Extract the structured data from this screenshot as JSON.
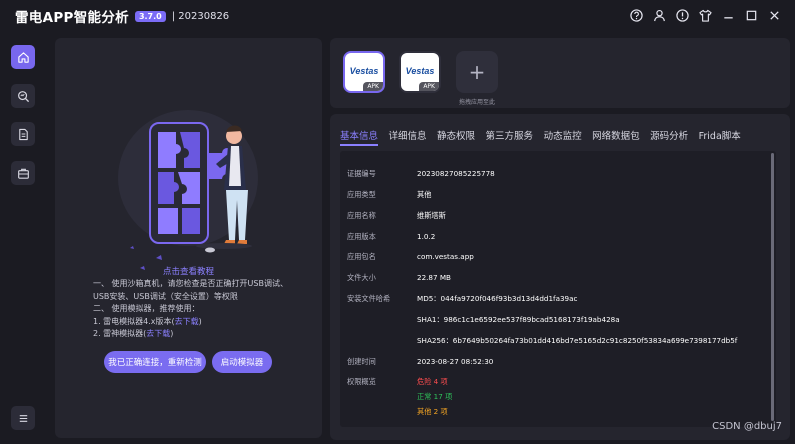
{
  "titlebar": {
    "app_name": "雷电APP智能分析",
    "version": "3.7.0",
    "build": "| 20230826",
    "icons": [
      "help-icon",
      "user-icon",
      "info-icon",
      "theme-icon",
      "minimize-icon",
      "maximize-icon",
      "close-icon"
    ]
  },
  "sidebar": {
    "items": [
      "home-icon",
      "analysis-icon",
      "report-icon",
      "toolbox-icon"
    ],
    "menu": "menu-icon",
    "accent": "#7867ee"
  },
  "guide": {
    "title": "点击查看教程",
    "line1": "一、 使用沙箱真机，请您检查是否正确打开USB调试、USB安装、USB调试（安全设置）等权限",
    "line2": "二、 使用模拟器，推荐使用：",
    "line3_prefix": "1. 雷电模拟器4.x版本(",
    "line3_link": "去下载",
    "line3_suffix": ")",
    "line4_prefix": "2. 雷神模拟器(",
    "line4_link": "去下载",
    "line4_suffix": ")",
    "btn_connected": "我已正确连接，重新检测",
    "btn_emulator": "启动模拟器"
  },
  "apk_bar": {
    "apps": [
      {
        "logo": "Vestas",
        "tag": "APK"
      },
      {
        "logo": "Vestas",
        "tag": "APK"
      }
    ],
    "add_label": "+",
    "drag_hint": "拖拽应用至此"
  },
  "tabs": [
    "基本信息",
    "详细信息",
    "静态权限",
    "第三方服务",
    "动态监控",
    "网络数据包",
    "源码分析",
    "Frida脚本"
  ],
  "basic_info": {
    "cert_no_label": "证据编号",
    "cert_no": "20230827085225778",
    "app_type_label": "应用类型",
    "app_type": "其他",
    "app_name_label": "应用名称",
    "app_name": "维斯塔斯",
    "version_label": "应用版本",
    "version": "1.0.2",
    "package_label": "应用包名",
    "package": "com.vestas.app",
    "size_label": "文件大小",
    "size": "22.87 MB",
    "hash_label": "安装文件哈希",
    "md5": "MD5：044fa9720f046f93b3d13d4dd1fa39ac",
    "sha1": "SHA1：986c1c1e6592ee537f89bcad5168173f19ab428a",
    "sha256": "SHA256：6b7649b50264fa73b01dd416bd7e5165d2c91c8250f53834a699e7398177db5f",
    "created_label": "创建时间",
    "created": "2023-08-27 08:52:30",
    "perm_label": "权限概览",
    "perm_danger": "危险 4 项",
    "perm_normal": "正常 17 项",
    "perm_other": "其他 2 项"
  },
  "watermark": "CSDN @dbuj7",
  "colors": {
    "danger": "#ff4d4f",
    "normal": "#2fc25b",
    "other": "#f5a623",
    "accent": "#8b80ff"
  }
}
